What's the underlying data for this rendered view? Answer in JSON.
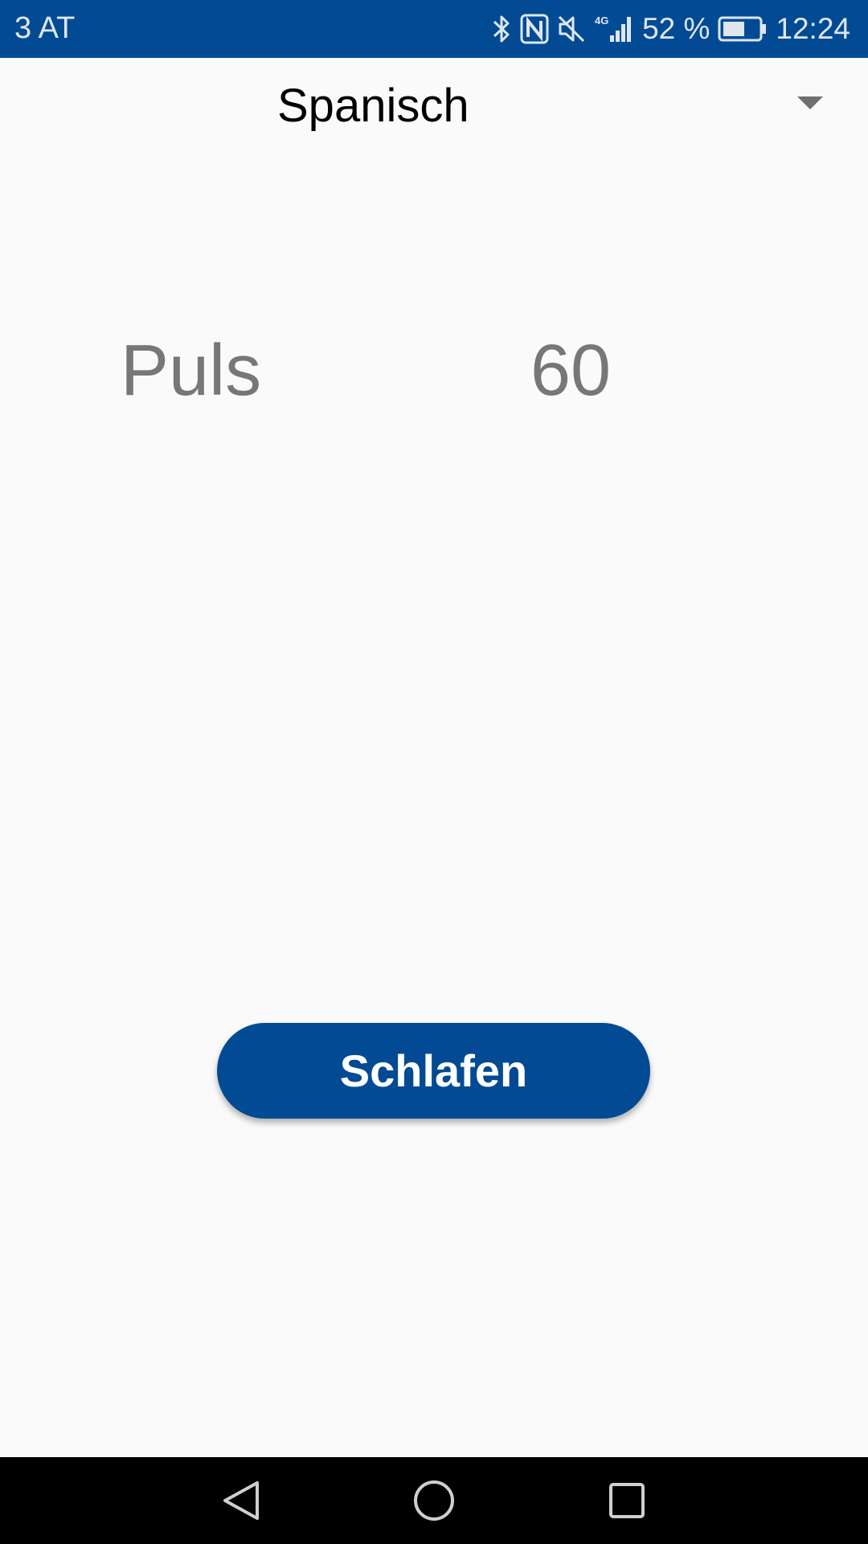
{
  "status_bar": {
    "carrier": "3 AT",
    "battery_percent": "52 %",
    "time": "12:24",
    "network_type": "4G",
    "icons": [
      "bluetooth-icon",
      "nfc-icon",
      "mute-icon",
      "signal-icon",
      "battery-icon"
    ],
    "background_color": "#024b94"
  },
  "spinner": {
    "selected_value": "Spanisch",
    "icon": "dropdown-arrow-icon"
  },
  "pulse": {
    "label": "Puls",
    "value": "60"
  },
  "sleep_button": {
    "label": "Schlafen",
    "color": "#024b94"
  },
  "nav_bar": {
    "icons": [
      "back-icon",
      "home-icon",
      "recents-icon"
    ]
  }
}
